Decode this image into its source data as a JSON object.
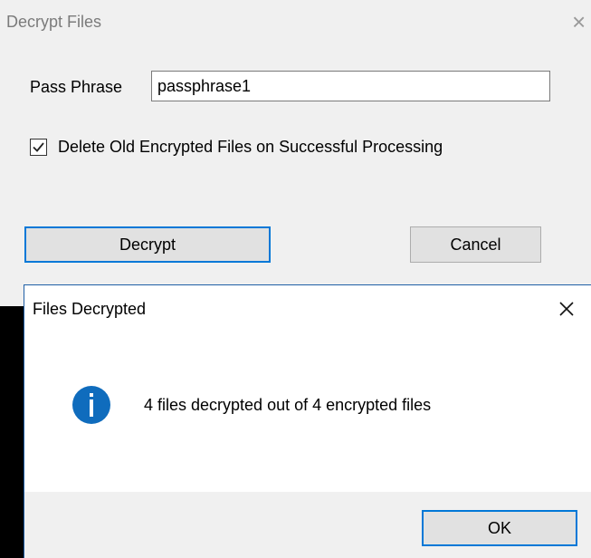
{
  "background_dialog": {
    "title": "Decrypt Files",
    "close_glyph": "×",
    "pass_phrase_label": "Pass Phrase",
    "pass_phrase_value": "passphrase1",
    "delete_checkbox_label": "Delete Old Encrypted Files on Successful Processing",
    "delete_checkbox_checked": true,
    "decrypt_button": "Decrypt",
    "cancel_button": "Cancel"
  },
  "message_box": {
    "title": "Files Decrypted",
    "icon": "info-icon",
    "message": "4 files decrypted out of 4 encrypted files",
    "ok_button": "OK"
  },
  "colors": {
    "accent": "#0078d7",
    "info_icon": "#0f6cbd",
    "window_bg": "#f0f0f0"
  }
}
